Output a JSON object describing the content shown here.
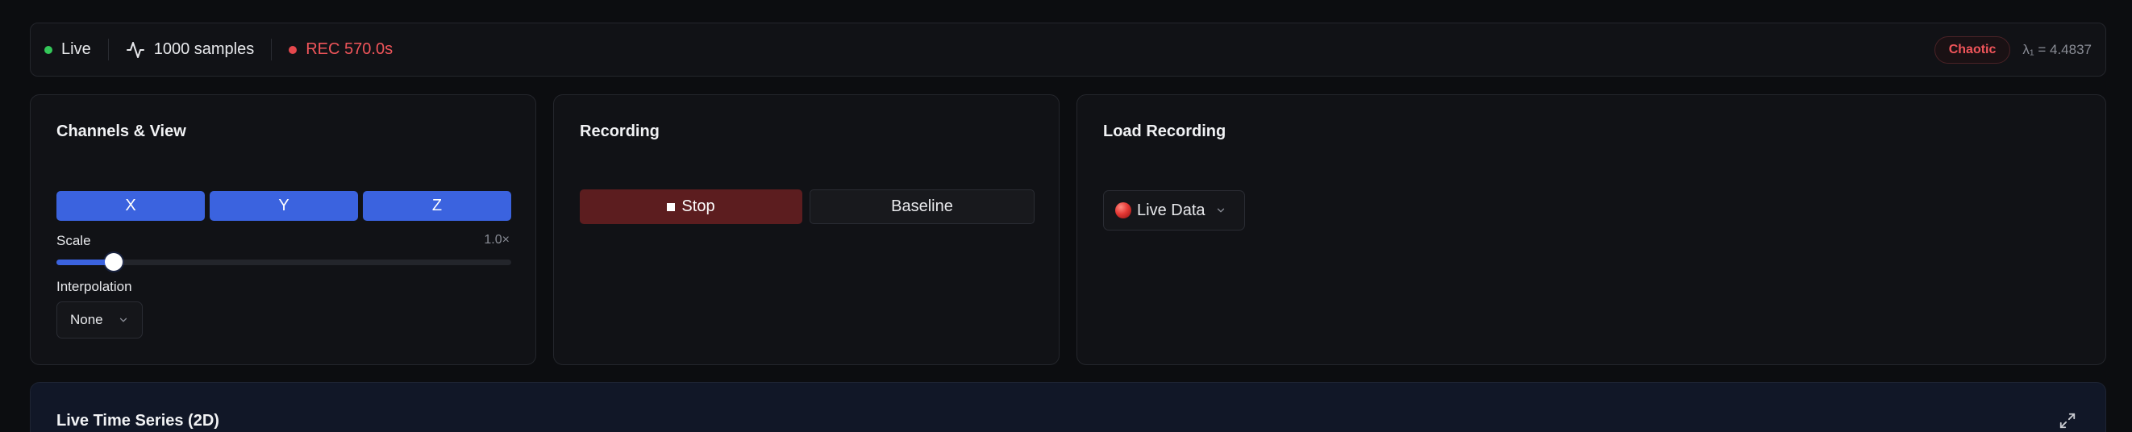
{
  "status": {
    "live_label": "Live",
    "samples_label": "1000 samples",
    "rec_label": "REC 570.0s",
    "badge_label": "Chaotic",
    "lyapunov_label": "λ₁ = 4.4837"
  },
  "channels_panel": {
    "title": "Channels & View",
    "channels": [
      "X",
      "Y",
      "Z"
    ],
    "scale_label": "Scale",
    "scale_value": "1.0×",
    "scale_fraction": 0.125,
    "interpolation_label": "Interpolation",
    "interpolation_value": "None"
  },
  "recording_panel": {
    "title": "Recording",
    "stop_label": "Stop",
    "baseline_label": "Baseline"
  },
  "load_panel": {
    "title": "Load Recording",
    "source_value": "Live Data"
  },
  "timeseries_panel": {
    "title": "Live Time Series (2D)"
  },
  "colors": {
    "accent": "#3b63df",
    "live": "#34c759",
    "recording": "#f0555a"
  },
  "icons": {
    "pulse": "activity-icon",
    "chevron": "chevron-down-icon",
    "expand": "expand-icon"
  }
}
